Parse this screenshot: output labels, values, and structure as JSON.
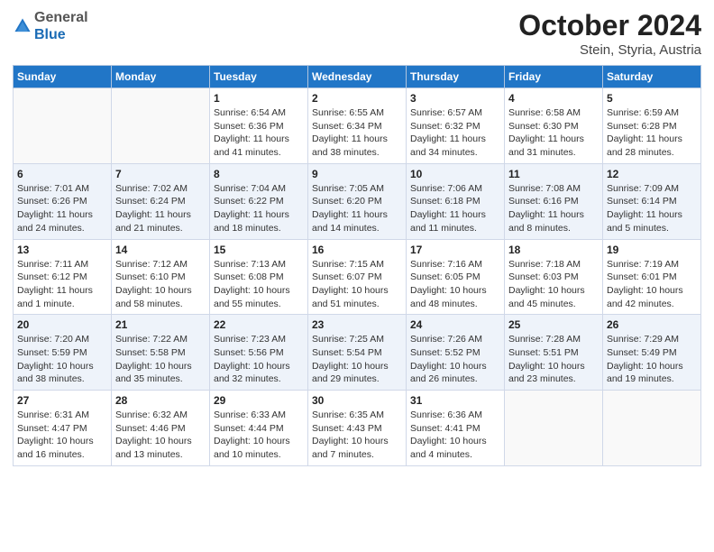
{
  "header": {
    "logo_general": "General",
    "logo_blue": "Blue",
    "title": "October 2024",
    "location": "Stein, Styria, Austria"
  },
  "weekdays": [
    "Sunday",
    "Monday",
    "Tuesday",
    "Wednesday",
    "Thursday",
    "Friday",
    "Saturday"
  ],
  "weeks": [
    [
      {
        "day": "",
        "sunrise": "",
        "sunset": "",
        "daylight": ""
      },
      {
        "day": "",
        "sunrise": "",
        "sunset": "",
        "daylight": ""
      },
      {
        "day": "1",
        "sunrise": "Sunrise: 6:54 AM",
        "sunset": "Sunset: 6:36 PM",
        "daylight": "Daylight: 11 hours and 41 minutes."
      },
      {
        "day": "2",
        "sunrise": "Sunrise: 6:55 AM",
        "sunset": "Sunset: 6:34 PM",
        "daylight": "Daylight: 11 hours and 38 minutes."
      },
      {
        "day": "3",
        "sunrise": "Sunrise: 6:57 AM",
        "sunset": "Sunset: 6:32 PM",
        "daylight": "Daylight: 11 hours and 34 minutes."
      },
      {
        "day": "4",
        "sunrise": "Sunrise: 6:58 AM",
        "sunset": "Sunset: 6:30 PM",
        "daylight": "Daylight: 11 hours and 31 minutes."
      },
      {
        "day": "5",
        "sunrise": "Sunrise: 6:59 AM",
        "sunset": "Sunset: 6:28 PM",
        "daylight": "Daylight: 11 hours and 28 minutes."
      }
    ],
    [
      {
        "day": "6",
        "sunrise": "Sunrise: 7:01 AM",
        "sunset": "Sunset: 6:26 PM",
        "daylight": "Daylight: 11 hours and 24 minutes."
      },
      {
        "day": "7",
        "sunrise": "Sunrise: 7:02 AM",
        "sunset": "Sunset: 6:24 PM",
        "daylight": "Daylight: 11 hours and 21 minutes."
      },
      {
        "day": "8",
        "sunrise": "Sunrise: 7:04 AM",
        "sunset": "Sunset: 6:22 PM",
        "daylight": "Daylight: 11 hours and 18 minutes."
      },
      {
        "day": "9",
        "sunrise": "Sunrise: 7:05 AM",
        "sunset": "Sunset: 6:20 PM",
        "daylight": "Daylight: 11 hours and 14 minutes."
      },
      {
        "day": "10",
        "sunrise": "Sunrise: 7:06 AM",
        "sunset": "Sunset: 6:18 PM",
        "daylight": "Daylight: 11 hours and 11 minutes."
      },
      {
        "day": "11",
        "sunrise": "Sunrise: 7:08 AM",
        "sunset": "Sunset: 6:16 PM",
        "daylight": "Daylight: 11 hours and 8 minutes."
      },
      {
        "day": "12",
        "sunrise": "Sunrise: 7:09 AM",
        "sunset": "Sunset: 6:14 PM",
        "daylight": "Daylight: 11 hours and 5 minutes."
      }
    ],
    [
      {
        "day": "13",
        "sunrise": "Sunrise: 7:11 AM",
        "sunset": "Sunset: 6:12 PM",
        "daylight": "Daylight: 11 hours and 1 minute."
      },
      {
        "day": "14",
        "sunrise": "Sunrise: 7:12 AM",
        "sunset": "Sunset: 6:10 PM",
        "daylight": "Daylight: 10 hours and 58 minutes."
      },
      {
        "day": "15",
        "sunrise": "Sunrise: 7:13 AM",
        "sunset": "Sunset: 6:08 PM",
        "daylight": "Daylight: 10 hours and 55 minutes."
      },
      {
        "day": "16",
        "sunrise": "Sunrise: 7:15 AM",
        "sunset": "Sunset: 6:07 PM",
        "daylight": "Daylight: 10 hours and 51 minutes."
      },
      {
        "day": "17",
        "sunrise": "Sunrise: 7:16 AM",
        "sunset": "Sunset: 6:05 PM",
        "daylight": "Daylight: 10 hours and 48 minutes."
      },
      {
        "day": "18",
        "sunrise": "Sunrise: 7:18 AM",
        "sunset": "Sunset: 6:03 PM",
        "daylight": "Daylight: 10 hours and 45 minutes."
      },
      {
        "day": "19",
        "sunrise": "Sunrise: 7:19 AM",
        "sunset": "Sunset: 6:01 PM",
        "daylight": "Daylight: 10 hours and 42 minutes."
      }
    ],
    [
      {
        "day": "20",
        "sunrise": "Sunrise: 7:20 AM",
        "sunset": "Sunset: 5:59 PM",
        "daylight": "Daylight: 10 hours and 38 minutes."
      },
      {
        "day": "21",
        "sunrise": "Sunrise: 7:22 AM",
        "sunset": "Sunset: 5:58 PM",
        "daylight": "Daylight: 10 hours and 35 minutes."
      },
      {
        "day": "22",
        "sunrise": "Sunrise: 7:23 AM",
        "sunset": "Sunset: 5:56 PM",
        "daylight": "Daylight: 10 hours and 32 minutes."
      },
      {
        "day": "23",
        "sunrise": "Sunrise: 7:25 AM",
        "sunset": "Sunset: 5:54 PM",
        "daylight": "Daylight: 10 hours and 29 minutes."
      },
      {
        "day": "24",
        "sunrise": "Sunrise: 7:26 AM",
        "sunset": "Sunset: 5:52 PM",
        "daylight": "Daylight: 10 hours and 26 minutes."
      },
      {
        "day": "25",
        "sunrise": "Sunrise: 7:28 AM",
        "sunset": "Sunset: 5:51 PM",
        "daylight": "Daylight: 10 hours and 23 minutes."
      },
      {
        "day": "26",
        "sunrise": "Sunrise: 7:29 AM",
        "sunset": "Sunset: 5:49 PM",
        "daylight": "Daylight: 10 hours and 19 minutes."
      }
    ],
    [
      {
        "day": "27",
        "sunrise": "Sunrise: 6:31 AM",
        "sunset": "Sunset: 4:47 PM",
        "daylight": "Daylight: 10 hours and 16 minutes."
      },
      {
        "day": "28",
        "sunrise": "Sunrise: 6:32 AM",
        "sunset": "Sunset: 4:46 PM",
        "daylight": "Daylight: 10 hours and 13 minutes."
      },
      {
        "day": "29",
        "sunrise": "Sunrise: 6:33 AM",
        "sunset": "Sunset: 4:44 PM",
        "daylight": "Daylight: 10 hours and 10 minutes."
      },
      {
        "day": "30",
        "sunrise": "Sunrise: 6:35 AM",
        "sunset": "Sunset: 4:43 PM",
        "daylight": "Daylight: 10 hours and 7 minutes."
      },
      {
        "day": "31",
        "sunrise": "Sunrise: 6:36 AM",
        "sunset": "Sunset: 4:41 PM",
        "daylight": "Daylight: 10 hours and 4 minutes."
      },
      {
        "day": "",
        "sunrise": "",
        "sunset": "",
        "daylight": ""
      },
      {
        "day": "",
        "sunrise": "",
        "sunset": "",
        "daylight": ""
      }
    ]
  ]
}
